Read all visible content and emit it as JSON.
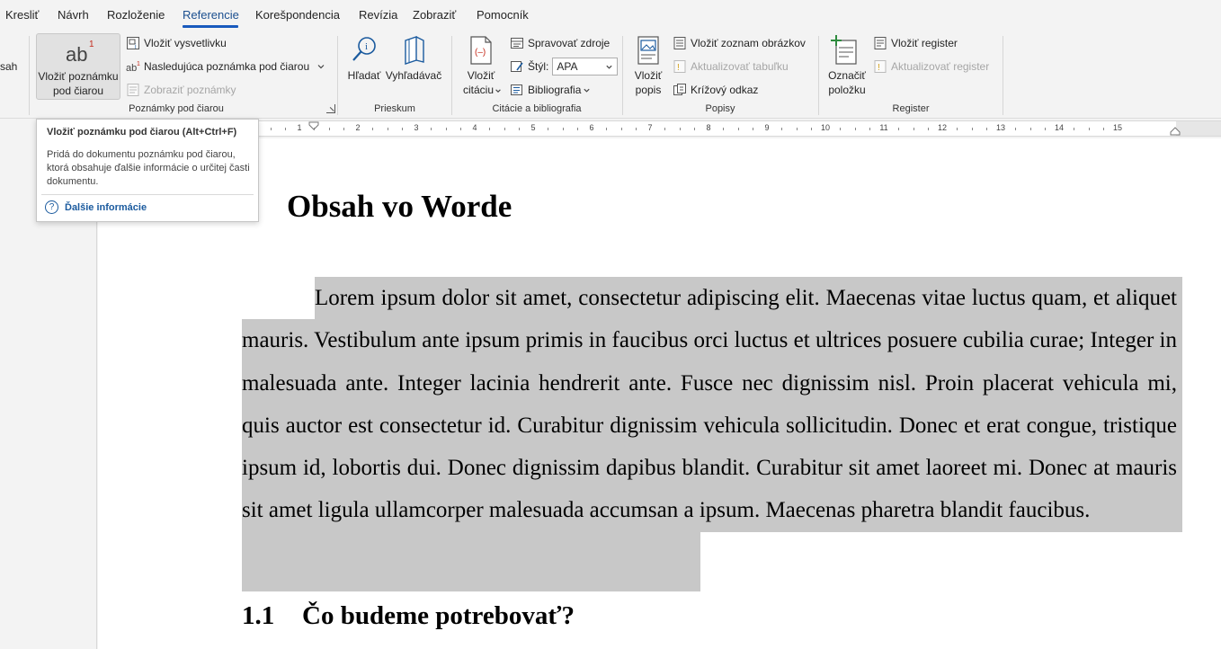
{
  "tabs": [
    {
      "label": "Kresliť"
    },
    {
      "label": "Návrh"
    },
    {
      "label": "Rozloženie"
    },
    {
      "label": "Referencie"
    },
    {
      "label": "Korešpondencia"
    },
    {
      "label": "Revízia"
    },
    {
      "label": "Zobraziť"
    },
    {
      "label": "Pomocník"
    }
  ],
  "active_tab": "Referencie",
  "ribbon": {
    "toc_partial": "sah",
    "footnotes": {
      "group_label": "Poznámky pod čiarou",
      "insert_footnote_line1": "Vložiť poznámku",
      "insert_footnote_line2": "pod čiarou",
      "footnote_icon_text": "ab",
      "footnote_icon_sup": "1",
      "insert_endnote": "Vložiť vysvetlivku",
      "next_footnote": "Nasledujúca poznámka pod čiarou",
      "show_notes": "Zobraziť poznámky"
    },
    "research": {
      "group_label": "Prieskum",
      "search": "Hľadať",
      "researcher": "Vyhľadávač"
    },
    "citations": {
      "group_label": "Citácie a bibliografia",
      "insert_citation_line1": "Vložiť",
      "insert_citation_line2": "citáciu",
      "manage_sources": "Spravovať zdroje",
      "style_label": "Štýl:",
      "style_value": "APA",
      "bibliography": "Bibliografia"
    },
    "captions": {
      "group_label": "Popisy",
      "insert_caption_line1": "Vložiť",
      "insert_caption_line2": "popis",
      "insert_table_of_figures": "Vložiť zoznam obrázkov",
      "update_table": "Aktualizovať tabuľku",
      "cross_reference": "Krížový odkaz"
    },
    "index": {
      "group_label": "Register",
      "mark_entry_line1": "Označiť",
      "mark_entry_line2": "položku",
      "insert_index": "Vložiť register",
      "update_index": "Aktualizovať register"
    }
  },
  "ruler": {
    "numbers": [
      "1",
      "2",
      "3",
      "4",
      "5",
      "6",
      "7",
      "8",
      "9",
      "10",
      "11",
      "12",
      "13",
      "14",
      "15"
    ]
  },
  "document": {
    "title": "Obsah vo Worde",
    "paragraph": "Lorem ipsum dolor sit amet, consectetur adipiscing elit. Maecenas vitae luctus quam, et aliquet mauris. Vestibulum ante ipsum primis in faucibus orci luctus et ultrices posuere cubilia curae; Integer in malesuada ante. Integer lacinia hendrerit ante. Fusce nec dignissim nisl. Proin placerat vehicula mi, quis auctor est consectetur id. Curabitur dignissim vehicula sollicitudin. Donec et erat congue, tristique ipsum id, lobortis dui. Donec dignissim dapibus blandit. Curabitur sit amet laoreet mi. Donec at mauris sit amet ligula ullamcorper malesuada accumsan a ipsum. Maecenas pharetra blandit faucibus.",
    "heading_number": "1.1",
    "heading_text": "Čo budeme potrebovať?"
  },
  "tooltip": {
    "title": "Vložiť poznámku pod čiarou (Alt+Ctrl+F)",
    "description": "Pridá do dokumentu poznámku pod čiarou, ktorá obsahuje ďalšie informácie o určitej časti dokumentu.",
    "help_icon": "?",
    "more_info": "Ďalšie informácie"
  },
  "colors": {
    "accent": "#185abd",
    "selection": "#c8c8c8",
    "ribbon_bg": "#f3f3f3"
  }
}
